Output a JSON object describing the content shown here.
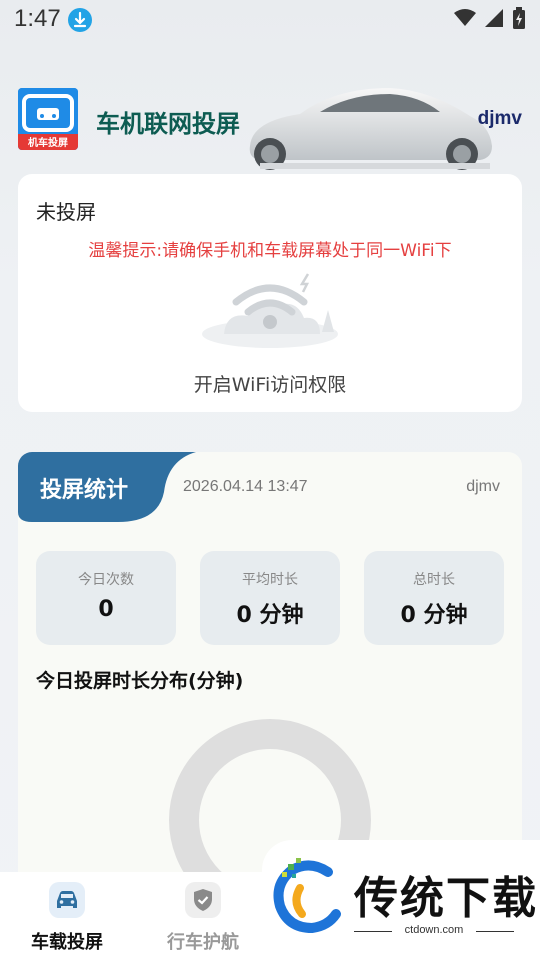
{
  "status_bar": {
    "time": "1:47"
  },
  "header": {
    "app_title": "车机联网投屏",
    "logo_text": "机车投屏",
    "user": "djmv"
  },
  "connection": {
    "status": "未投屏",
    "tip": "温馨提示:请确保手机和车载屏幕处于同一WiFi下",
    "wifi_permission": "开启WiFi访问权限"
  },
  "stats": {
    "title": "投屏统计",
    "datetime": "2026.04.14 13:47",
    "user": "djmv",
    "items": [
      {
        "label": "今日次数",
        "value": "0"
      },
      {
        "label": "平均时长",
        "value": "0 分钟"
      },
      {
        "label": "总时长",
        "value": "0 分钟"
      }
    ],
    "distribution_title": "今日投屏时长分布(分钟)"
  },
  "bottom_nav": {
    "items": [
      {
        "label": "车载投屏",
        "icon": "car-icon",
        "active": true
      },
      {
        "label": "行车护航",
        "icon": "shield-check-icon",
        "active": false
      }
    ]
  },
  "watermark": {
    "brand": "传统下载",
    "domain": "ctdown.com"
  },
  "colors": {
    "accent": "#2f6fa0",
    "tip_red": "#e54040",
    "title_green": "#0d5c52",
    "donut_gray": "#dedede"
  }
}
